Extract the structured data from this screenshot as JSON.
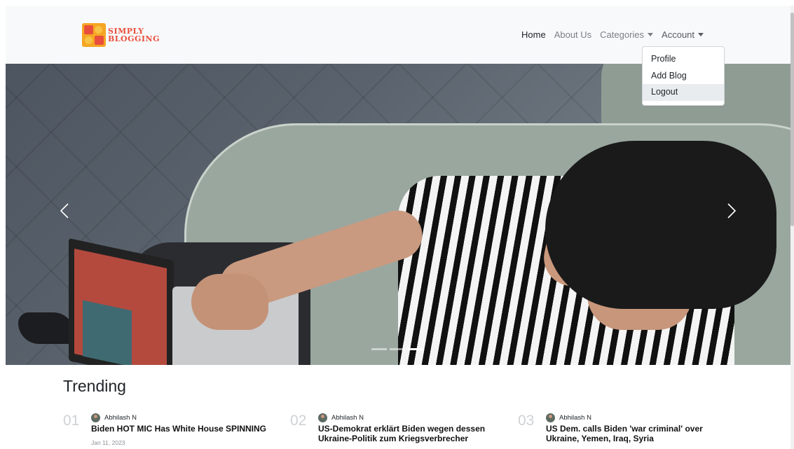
{
  "brand": {
    "line1": "SIMPLY",
    "line2": "BLOGGING",
    "color": "#e94e3c"
  },
  "nav": {
    "home": "Home",
    "about": "About Us",
    "categories": "Categories",
    "account": "Account"
  },
  "account_menu": {
    "items": [
      "Profile",
      "Add Blog",
      "Logout"
    ],
    "active": "Logout"
  },
  "carousel": {
    "slides": 3,
    "active_slide": 3,
    "prev_icon": "chevron-left-icon",
    "next_icon": "chevron-right-icon"
  },
  "trending": {
    "title": "Trending",
    "items": [
      {
        "num": "01",
        "author": "Abhilash N",
        "title": "Biden HOT MIC Has White House SPINNING",
        "date": "Jan 11, 2023"
      },
      {
        "num": "02",
        "author": "Abhilash N",
        "title": "US-Demokrat erklärt Biden wegen dessen Ukraine-Politik zum Kriegsverbrecher",
        "date": ""
      },
      {
        "num": "03",
        "author": "Abhilash N",
        "title": "US Dem. calls Biden 'war criminal' over Ukraine, Yemen, Iraq, Syria",
        "date": ""
      }
    ]
  }
}
